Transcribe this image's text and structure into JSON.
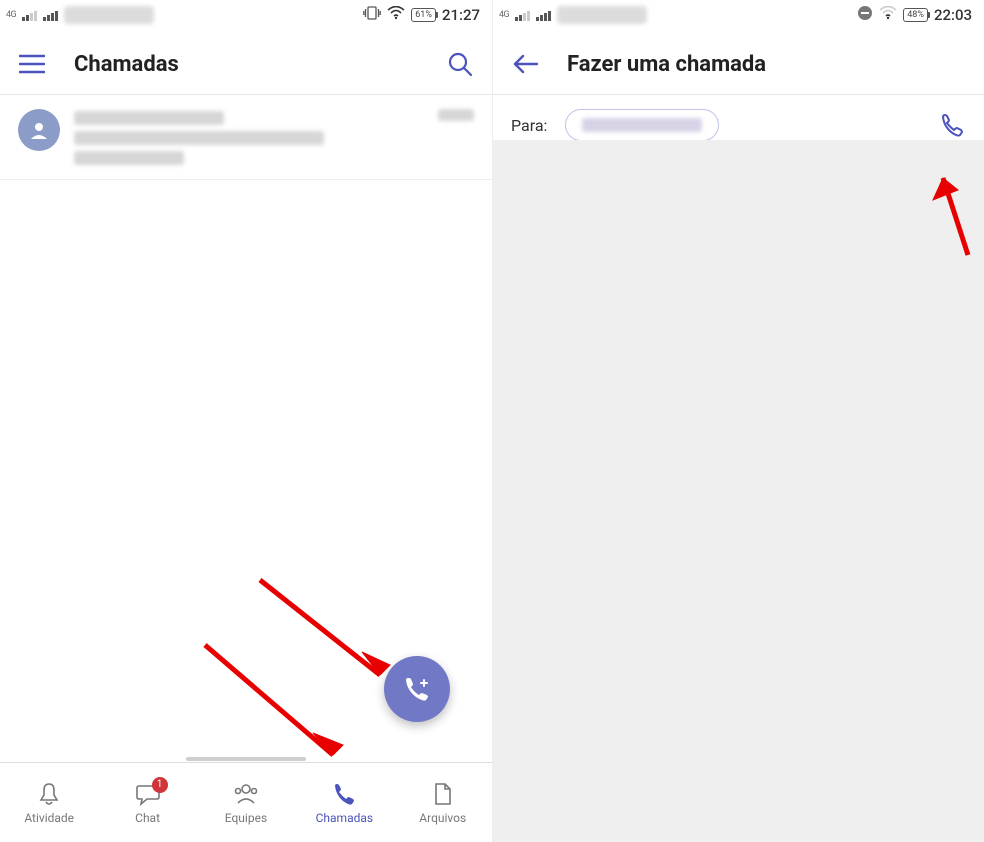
{
  "left": {
    "status": {
      "network": "4G",
      "battery": "61%",
      "time": "21:27"
    },
    "header": {
      "title": "Chamadas"
    },
    "nav": {
      "items": [
        {
          "label": "Atividade",
          "id": "atividade"
        },
        {
          "label": "Chat",
          "id": "chat",
          "badge": "1"
        },
        {
          "label": "Equipes",
          "id": "equipes"
        },
        {
          "label": "Chamadas",
          "id": "chamadas",
          "active": true
        },
        {
          "label": "Arquivos",
          "id": "arquivos"
        }
      ]
    }
  },
  "right": {
    "status": {
      "network": "4G",
      "battery": "48%",
      "time": "22:03"
    },
    "header": {
      "title": "Fazer uma chamada"
    },
    "para_label": "Para:"
  }
}
